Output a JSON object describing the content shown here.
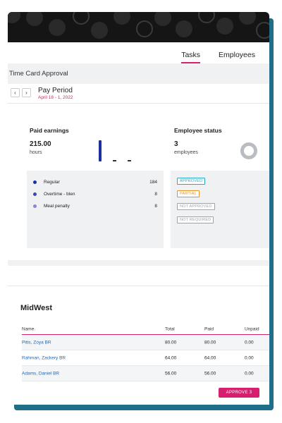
{
  "tabs": [
    {
      "label": "Tasks",
      "active": true
    },
    {
      "label": "Employees",
      "active": false
    }
  ],
  "section_title": "Time Card Approval",
  "pay_period": {
    "label": "Pay Period",
    "dates": "April 18 - 1, 2022",
    "prev_icon": "chevron-left-icon",
    "next_icon": "chevron-right-icon"
  },
  "paid_earnings": {
    "title": "Paid earnings",
    "value": "215.00",
    "unit": "hours",
    "bars": [
      184,
      8,
      8
    ]
  },
  "employee_status": {
    "title": "Employee status",
    "value": "3",
    "unit": "employees",
    "chart_icon": "donut-chart-icon"
  },
  "legend": [
    {
      "label": "Regular",
      "value": "184",
      "color": "#1c2fa0"
    },
    {
      "label": "Overtime - blen",
      "value": "8",
      "color": "#3b46b8"
    },
    {
      "label": "Meal penalty",
      "value": "8",
      "color": "#8a86cf"
    }
  ],
  "statuses": [
    {
      "label": "APPROVED",
      "color": "#2aa9c4"
    },
    {
      "label": "PARTIAL",
      "color": "#e2952a"
    },
    {
      "label": "NOT APPROVED",
      "color": "#9ea3a8"
    },
    {
      "label": "NOT REQUIRED",
      "color": "#9ea3a8"
    }
  ],
  "region_title": "MidWest",
  "table": {
    "headers": {
      "name": "Name",
      "total": "Total",
      "paid": "Paid",
      "unpaid": "Unpaid"
    },
    "rows": [
      {
        "name": "Pitts, Zoya BR",
        "total": "80.00",
        "paid": "80.00",
        "unpaid": "0.00"
      },
      {
        "name": "Rahman, Zackery BR",
        "total": "64.00",
        "paid": "64.00",
        "unpaid": "0.00"
      },
      {
        "name": "Adams, Daniel BR",
        "total": "56.00",
        "paid": "56.00",
        "unpaid": "0.00"
      }
    ]
  },
  "approve_label": "APPROVE 3",
  "colors": {
    "accent": "#d6206f",
    "link": "#1e66b5",
    "card_shadow": "#1f6f8b",
    "banner": "#151515"
  }
}
